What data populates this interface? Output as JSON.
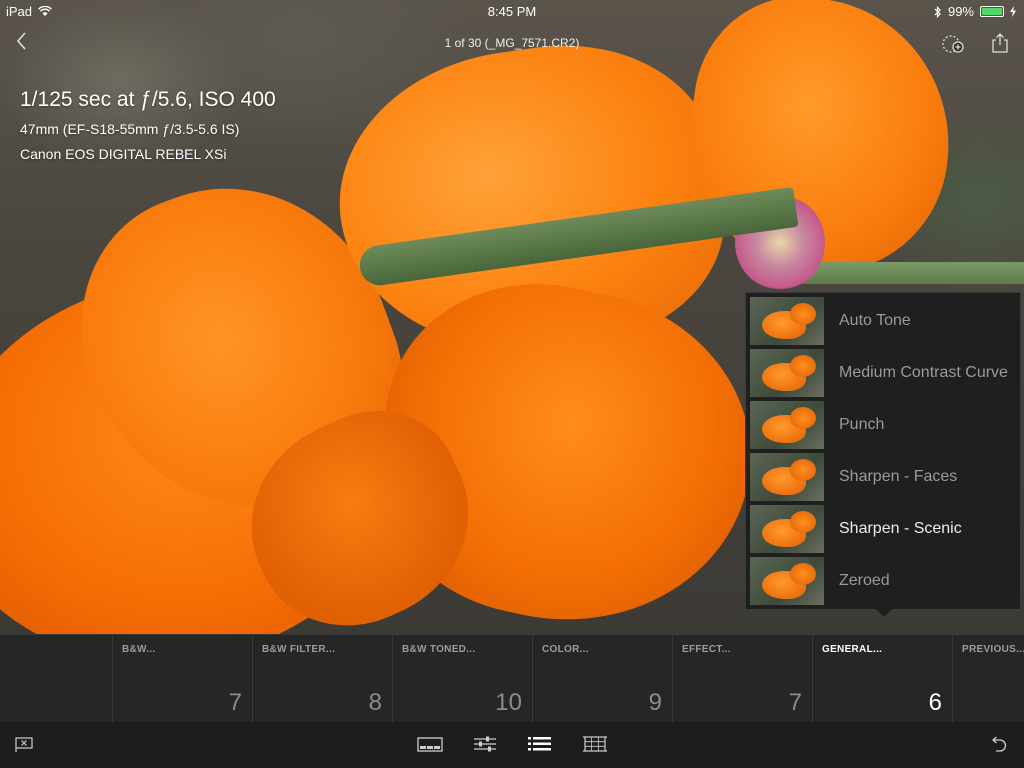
{
  "status_bar": {
    "device": "iPad",
    "time": "8:45 PM",
    "battery_percent": "99%",
    "battery_level": 0.99,
    "icons": [
      "wifi-icon",
      "bluetooth-icon",
      "battery-icon"
    ]
  },
  "nav": {
    "title": "1 of 30 (_MG_7571.CR2)",
    "icons": {
      "back": "chevron-left-icon",
      "add_collection": "add-to-collection-icon",
      "share": "share-icon"
    }
  },
  "exif": {
    "exposure": "1/125 sec at ƒ/5.6, ISO 400",
    "lens": "47mm (EF-S18-55mm ƒ/3.5-5.6 IS)",
    "camera": "Canon EOS DIGITAL REBEL XSi"
  },
  "presets_popover": {
    "items": [
      {
        "name": "Auto Tone",
        "active": false
      },
      {
        "name": "Medium Contrast Curve",
        "active": false
      },
      {
        "name": "Punch",
        "active": false
      },
      {
        "name": "Sharpen - Faces",
        "active": false
      },
      {
        "name": "Sharpen - Scenic",
        "active": true
      },
      {
        "name": "Zeroed",
        "active": false
      }
    ]
  },
  "categories": [
    {
      "label": "B&W...",
      "count": "7",
      "active": false
    },
    {
      "label": "B&W FILTER...",
      "count": "8",
      "active": false
    },
    {
      "label": "B&W TONED...",
      "count": "10",
      "active": false
    },
    {
      "label": "COLOR...",
      "count": "9",
      "active": false
    },
    {
      "label": "EFFECT...",
      "count": "7",
      "active": false
    },
    {
      "label": "GENERAL...",
      "count": "6",
      "active": true
    },
    {
      "label": "PREVIOUS...",
      "count": "",
      "active": false
    }
  ],
  "toolbar": {
    "icons": [
      "flag-reject-icon",
      "filmstrip-icon",
      "adjust-sliders-icon",
      "presets-list-icon",
      "crop-icon",
      "undo-icon"
    ],
    "active": "presets-list-icon"
  },
  "colors": {
    "accent_active": "#ffffff",
    "inactive_text": "#9a9a9a",
    "strip_bg": "#262626",
    "toolbar_bg": "#1d1d1d",
    "battery_green": "#4cd964"
  }
}
